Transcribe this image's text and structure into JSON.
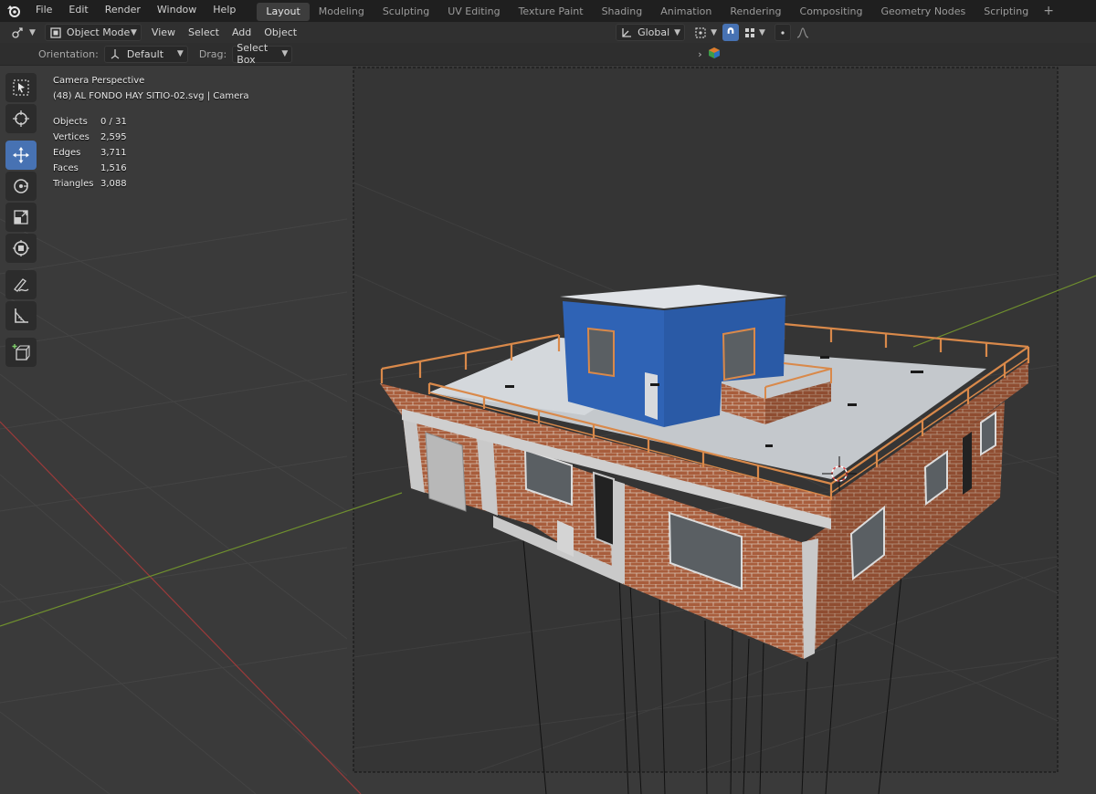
{
  "topbar": {
    "menus": [
      "File",
      "Edit",
      "Render",
      "Window",
      "Help"
    ],
    "workspaces": [
      "Layout",
      "Modeling",
      "Sculpting",
      "UV Editing",
      "Texture Paint",
      "Shading",
      "Animation",
      "Rendering",
      "Compositing",
      "Geometry Nodes",
      "Scripting"
    ],
    "active_workspace": "Layout",
    "add_tab": "+"
  },
  "header": {
    "mode": "Object Mode",
    "menus": [
      "View",
      "Select",
      "Add",
      "Object"
    ],
    "transform_orientation": "Global"
  },
  "toolsettings": {
    "orientation_label": "Orientation:",
    "orientation_value": "Default",
    "drag_label": "Drag:",
    "drag_value": "Select Box"
  },
  "overlay": {
    "view_name": "Camera Perspective",
    "object_info": "(48) AL FONDO HAY SITIO-02.svg | Camera",
    "stats": [
      {
        "label": "Objects",
        "value": "0 / 31"
      },
      {
        "label": "Vertices",
        "value": "2,595"
      },
      {
        "label": "Edges",
        "value": "3,711"
      },
      {
        "label": "Faces",
        "value": "1,516"
      },
      {
        "label": "Triangles",
        "value": "3,088"
      }
    ]
  },
  "toolbar": {
    "tools": [
      "select-box-icon",
      "cursor-icon",
      "move-icon",
      "rotate-icon",
      "scale-icon",
      "transform-icon",
      "annotate-icon",
      "measure-icon",
      "add-cube-icon"
    ],
    "active_tool": "move-icon"
  },
  "colors": {
    "accent": "#4772b3",
    "brick": "#a85d3c",
    "railing": "#d9894a",
    "upper_room": "#2f63b5",
    "x_axis": "#9b3a3a",
    "y_axis": "#6f8f2e"
  }
}
